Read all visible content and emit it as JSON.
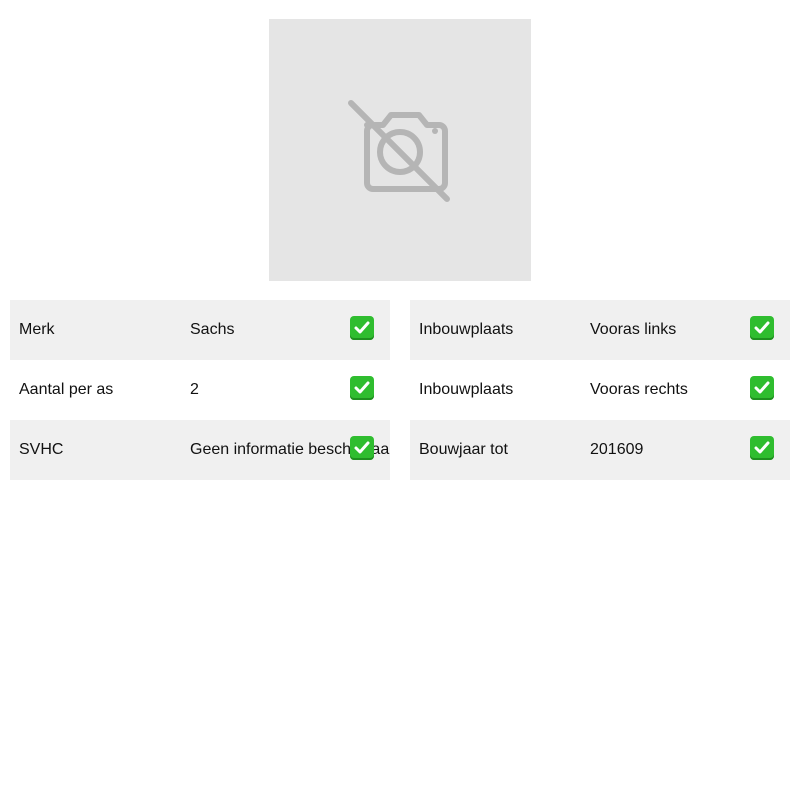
{
  "image": {
    "icon": "no-camera-icon"
  },
  "left_table": {
    "rows": [
      {
        "label": "Merk",
        "value": "Sachs"
      },
      {
        "label": "Aantal per as",
        "value": "2"
      },
      {
        "label": "SVHC",
        "value": "Geen informatie beschikbaar"
      }
    ]
  },
  "right_table": {
    "rows": [
      {
        "label": "Inbouwplaats",
        "value": "Vooras links"
      },
      {
        "label": "Inbouwplaats",
        "value": "Vooras rechts"
      },
      {
        "label": "Bouwjaar tot",
        "value": "201609"
      }
    ]
  },
  "colors": {
    "check_green": "#2fbd2f",
    "row_stripe": "#f0f0f0",
    "placeholder": "#e5e5e5"
  }
}
